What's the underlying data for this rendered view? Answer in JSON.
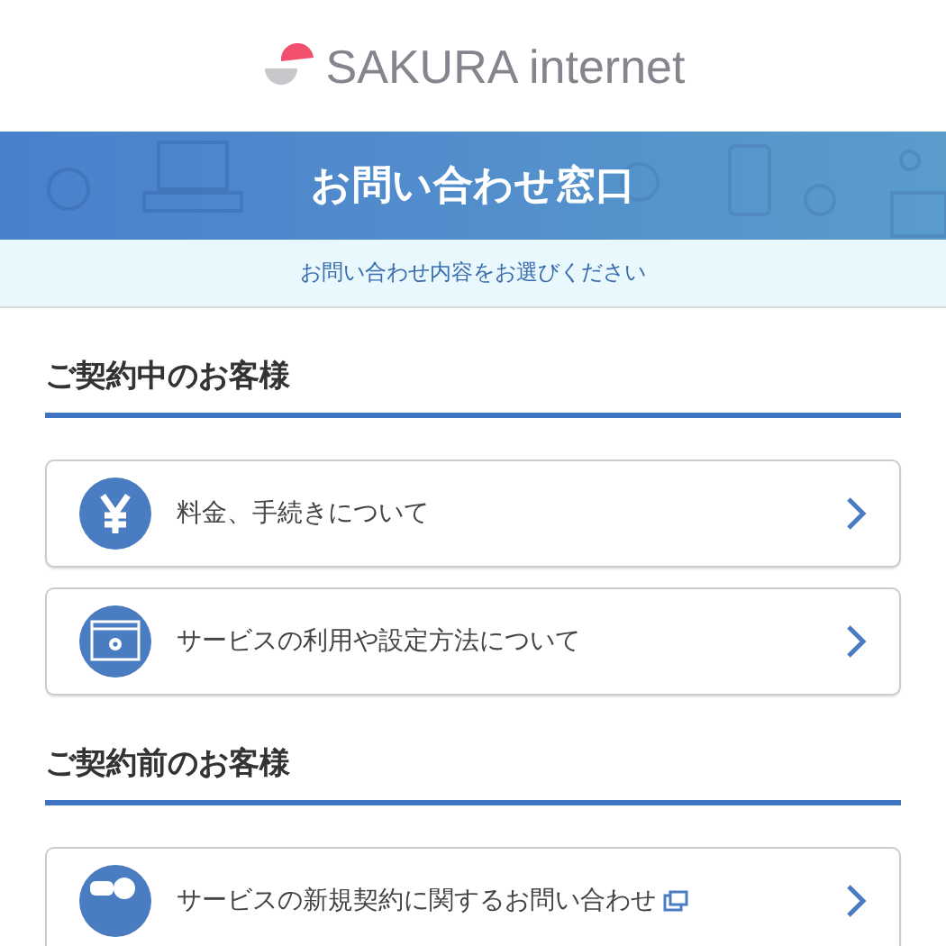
{
  "logo": {
    "text": "SAKURA internet"
  },
  "banner": {
    "title": "お問い合わせ窓口",
    "subtitle": "お問い合わせ内容をお選びください"
  },
  "sections": [
    {
      "heading": "ご契約中のお客様",
      "items": [
        {
          "kind": "yen",
          "label": "料金、手続きについて",
          "external": false
        },
        {
          "kind": "settings",
          "label": "サービスの利用や設定方法について",
          "external": false
        }
      ]
    },
    {
      "heading": "ご契約前のお客様",
      "items": [
        {
          "kind": "chat",
          "label": "サービスの新規契約に関するお問い合わせ",
          "external": true
        }
      ]
    }
  ]
}
